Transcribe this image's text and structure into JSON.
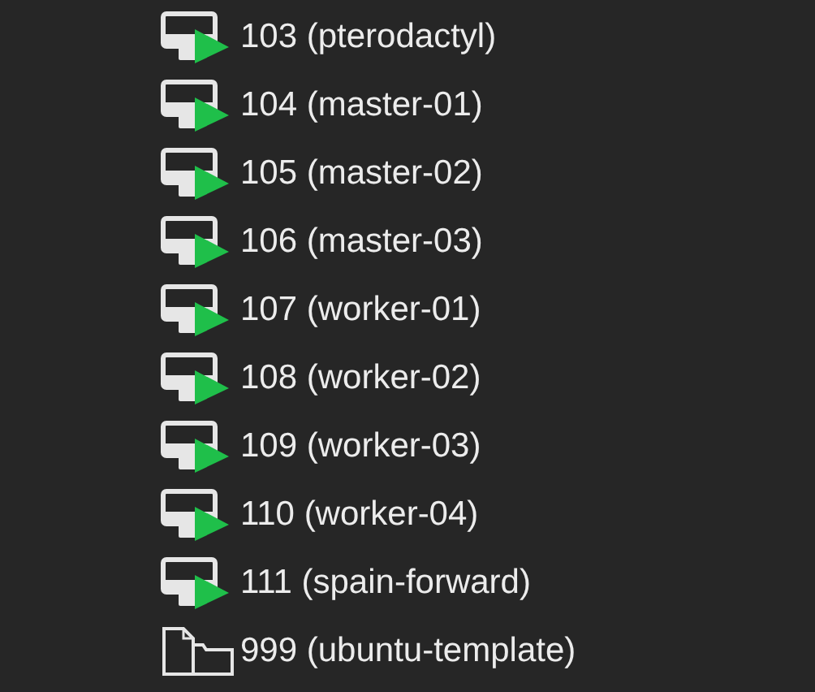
{
  "tree": {
    "items": [
      {
        "kind": "running_vm",
        "label": "103 (pterodactyl)"
      },
      {
        "kind": "running_vm",
        "label": "104 (master-01)"
      },
      {
        "kind": "running_vm",
        "label": "105 (master-02)"
      },
      {
        "kind": "running_vm",
        "label": "106 (master-03)"
      },
      {
        "kind": "running_vm",
        "label": "107 (worker-01)"
      },
      {
        "kind": "running_vm",
        "label": "108 (worker-02)"
      },
      {
        "kind": "running_vm",
        "label": "109 (worker-03)"
      },
      {
        "kind": "running_vm",
        "label": "110 (worker-04)"
      },
      {
        "kind": "running_vm",
        "label": "111 (spain-forward)"
      },
      {
        "kind": "template",
        "label": "999 (ubuntu-template)"
      }
    ]
  }
}
